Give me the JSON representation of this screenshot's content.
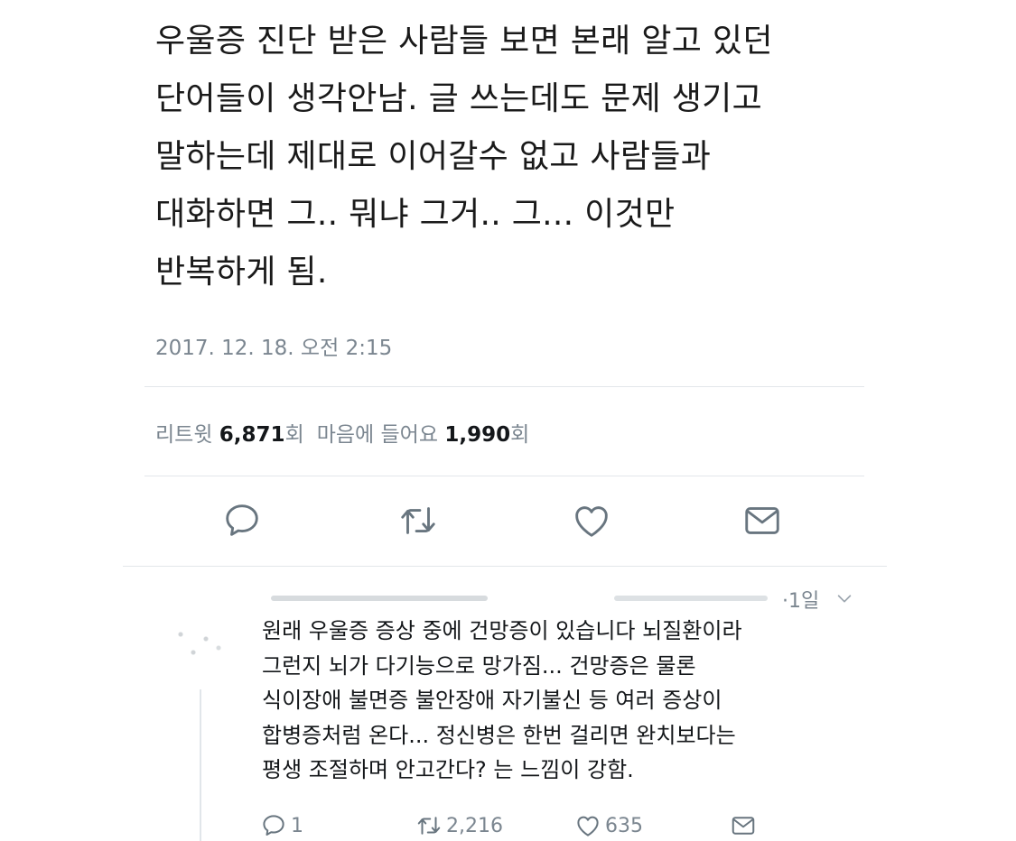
{
  "tweet": {
    "lines": [
      "우울증 진단 받은 사람들 보면 본래 알고 있던",
      "단어들이 생각안남. 글 쓰는데도 문제 생기고",
      "말하는데 제대로 이어갈수 없고 사람들과",
      "대화하면 그.. 뭐냐 그거.. 그... 이것만",
      "반복하게 됨."
    ],
    "timestamp": "2017. 12. 18. 오전 2:15",
    "stats": {
      "retweet_label": "리트윗",
      "retweet_count": "6,871",
      "retweet_unit": "회",
      "like_label": "마음에 들어요",
      "like_count": "1,990",
      "like_unit": "회"
    },
    "actions": {
      "reply_icon": "reply-icon",
      "retweet_icon": "retweet-icon",
      "like_icon": "heart-icon",
      "message_icon": "envelope-icon"
    }
  },
  "reply": {
    "time": "·1일",
    "lines": [
      "원래 우울증 증상 중에 건망증이 있습니다 뇌질환이라",
      "그런지 뇌가 다기능으로 망가짐... 건망증은 물론",
      "식이장애 불면증 불안장애 자기불신 등 여러 증상이",
      "합병증처럼 온다... 정신병은 한번 걸리면 완치보다는",
      "평생 조절하며 안고간다? 는 느낌이 강함."
    ],
    "counts": {
      "reply": "1",
      "retweet": "2,216",
      "like": "635"
    }
  },
  "colors": {
    "text": "#14171a",
    "muted": "#7b8690",
    "divider": "#e3e7ea"
  }
}
